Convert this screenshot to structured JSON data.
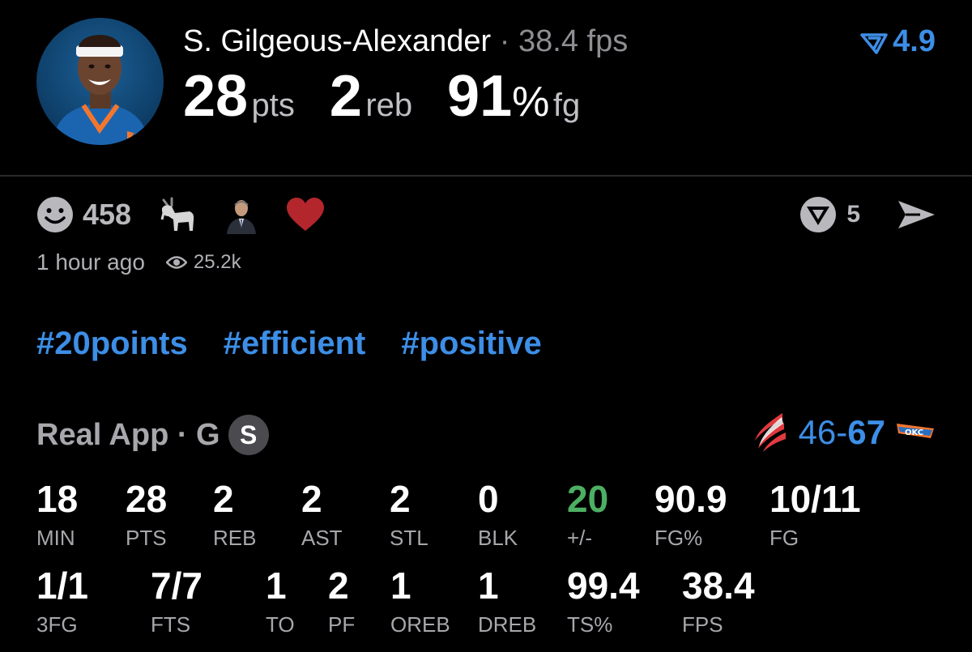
{
  "header": {
    "player_name": "S. Gilgeous-Alexander",
    "separator": "·",
    "fps_text": "38.4 fps",
    "rating": "4.9",
    "headline": {
      "pts": "28",
      "pts_unit": "pts",
      "reb": "2",
      "reb_unit": "reb",
      "fg": "91",
      "fg_pct_sign": "%",
      "fg_unit": "fg"
    }
  },
  "social": {
    "reaction_count": "458",
    "vote_count": "5",
    "time_ago": "1 hour ago",
    "views": "25.2k"
  },
  "hashtags": [
    "#20points",
    "#efficient",
    "#positive"
  ],
  "app_line": {
    "label": "Real App · G",
    "badge": "S",
    "score_away": "46-",
    "score_home": "67"
  },
  "stats_row1": [
    {
      "value": "18",
      "label": "MIN"
    },
    {
      "value": "28",
      "label": "PTS"
    },
    {
      "value": "2",
      "label": "REB"
    },
    {
      "value": "2",
      "label": "AST"
    },
    {
      "value": "2",
      "label": "STL"
    },
    {
      "value": "0",
      "label": "BLK"
    },
    {
      "value": "20",
      "label": "+/-"
    },
    {
      "value": "90.9",
      "label": "FG%"
    },
    {
      "value": "10/11",
      "label": "FG"
    }
  ],
  "stats_row2": [
    {
      "value": "1/1",
      "label": "3FG"
    },
    {
      "value": "7/7",
      "label": "FTS"
    },
    {
      "value": "1",
      "label": "TO"
    },
    {
      "value": "2",
      "label": "PF"
    },
    {
      "value": "1",
      "label": "OREB"
    },
    {
      "value": "1",
      "label": "DREB"
    },
    {
      "value": "99.4",
      "label": "TS%"
    },
    {
      "value": "38.4",
      "label": "FPS"
    }
  ],
  "colors": {
    "accent_blue": "#3d8ee6",
    "positive_green": "#4caf63",
    "muted": "#a7a7ac",
    "background": "#000000"
  },
  "icons": [
    "smiley-icon",
    "goat-icon",
    "commissioner-icon",
    "heart-icon",
    "vote-icon",
    "send-icon",
    "eye-icon",
    "blazers-logo",
    "thunder-logo",
    "rating-icon"
  ]
}
